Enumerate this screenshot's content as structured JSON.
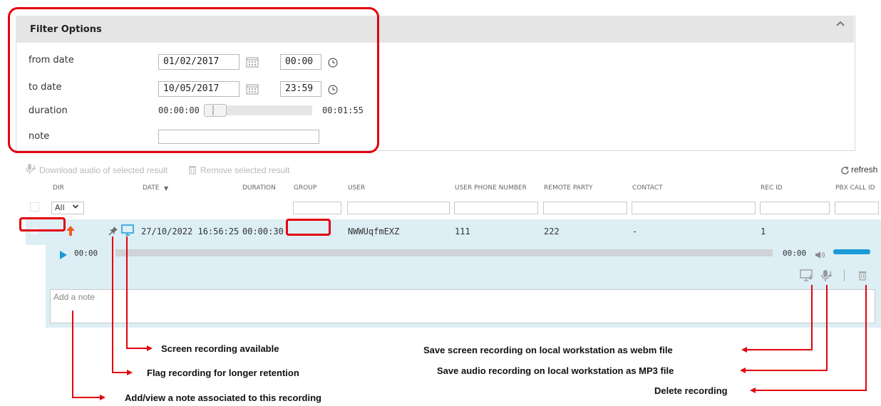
{
  "filter": {
    "title": "Filter Options",
    "from_label": "from date",
    "from_date": "01/02/2017",
    "from_time": "00:00",
    "to_label": "to date",
    "to_date": "10/05/2017",
    "to_time": "23:59",
    "duration_label": "duration",
    "duration_min": "00:00:00",
    "duration_max": "00:01:55",
    "note_label": "note"
  },
  "toolbar": {
    "download_label": "Download audio of selected result",
    "remove_label": "Remove selected result",
    "refresh_label": "refresh"
  },
  "table": {
    "headers": {
      "dir": "DIR",
      "date": "DATE",
      "duration": "DURATION",
      "group": "GROUP",
      "user": "USER",
      "user_phone": "USER PHONE NUMBER",
      "remote_party": "REMOTE PARTY",
      "contact": "CONTACT",
      "rec_id": "REC ID",
      "pbx_call_id": "PBX CALL ID"
    },
    "dir_filter": "All",
    "row": {
      "date": "27/10/2022 16:56:25",
      "duration": "00:00:30",
      "group": "",
      "user": "NWWUqfmEXZ",
      "user_phone": "111",
      "remote_party": "222",
      "contact": "-",
      "rec_id": "1"
    }
  },
  "player": {
    "current_time": "00:00",
    "end_time": "00:00",
    "note_placeholder": "Add a note"
  },
  "annotations": {
    "screen_recording": "Screen recording available",
    "flag": "Flag recording for longer retention",
    "note": "Add/view a note associated to this recording",
    "save_webm": "Save screen recording on local workstation as webm file",
    "save_mp3": "Save audio recording on local workstation as MP3 file",
    "delete": "Delete recording"
  },
  "colors": {
    "annotation_red": "#e3000f",
    "accent_blue": "#1a9ad6",
    "direction_orange": "#f15a22"
  }
}
